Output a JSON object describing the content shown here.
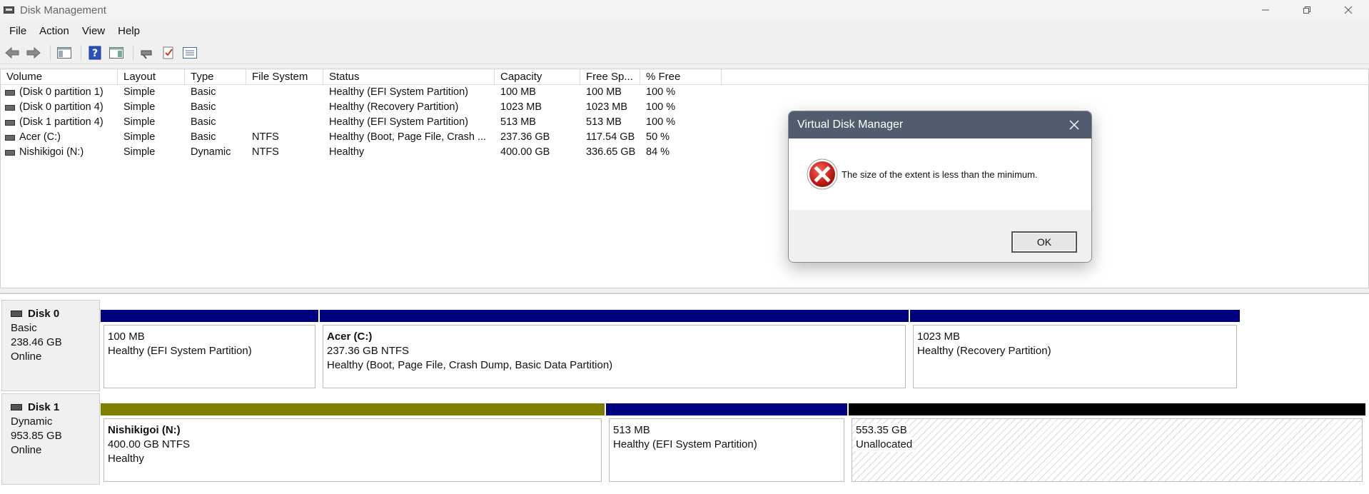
{
  "window": {
    "title": "Disk Management"
  },
  "menu": [
    "File",
    "Action",
    "View",
    "Help"
  ],
  "volume_table": {
    "columns": [
      "Volume",
      "Layout",
      "Type",
      "File System",
      "Status",
      "Capacity",
      "Free Sp...",
      "% Free"
    ],
    "rows": [
      [
        "(Disk 0 partition 1)",
        "Simple",
        "Basic",
        "",
        "Healthy (EFI System Partition)",
        "100 MB",
        "100 MB",
        "100 %"
      ],
      [
        "(Disk 0 partition 4)",
        "Simple",
        "Basic",
        "",
        "Healthy (Recovery Partition)",
        "1023 MB",
        "1023 MB",
        "100 %"
      ],
      [
        "(Disk 1 partition 4)",
        "Simple",
        "Basic",
        "",
        "Healthy (EFI System Partition)",
        "513 MB",
        "513 MB",
        "100 %"
      ],
      [
        "Acer (C:)",
        "Simple",
        "Basic",
        "NTFS",
        "Healthy (Boot, Page File, Crash ...",
        "237.36 GB",
        "117.54 GB",
        "50 %"
      ],
      [
        "Nishikigoi (N:)",
        "Simple",
        "Dynamic",
        "NTFS",
        "Healthy",
        "400.00 GB",
        "336.65 GB",
        "84 %"
      ]
    ]
  },
  "disks": [
    {
      "name": "Disk 0",
      "type": "Basic",
      "size": "238.46 GB",
      "status": "Online",
      "partitions": [
        {
          "name": "",
          "size": "100 MB",
          "status": "Healthy (EFI System Partition)",
          "bar_color": "#000080"
        },
        {
          "name": "Acer  (C:)",
          "size": "237.36 GB NTFS",
          "status": "Healthy (Boot, Page File, Crash Dump, Basic Data Partition)",
          "bar_color": "#000080"
        },
        {
          "name": "",
          "size": "1023 MB",
          "status": "Healthy (Recovery Partition)",
          "bar_color": "#000080"
        }
      ]
    },
    {
      "name": "Disk 1",
      "type": "Dynamic",
      "size": "953.85 GB",
      "status": "Online",
      "partitions": [
        {
          "name": "Nishikigoi  (N:)",
          "size": "400.00 GB NTFS",
          "status": "Healthy",
          "bar_color": "#808000"
        },
        {
          "name": "",
          "size": "513 MB",
          "status": "Healthy (EFI System Partition)",
          "bar_color": "#000080"
        },
        {
          "name": "",
          "size": "553.35 GB",
          "status": "Unallocated",
          "bar_color": "#000000"
        }
      ]
    }
  ],
  "dialog": {
    "title": "Virtual Disk Manager",
    "message": "The size of the extent is less than the minimum.",
    "ok_label": "OK",
    "icon": "error-icon"
  }
}
